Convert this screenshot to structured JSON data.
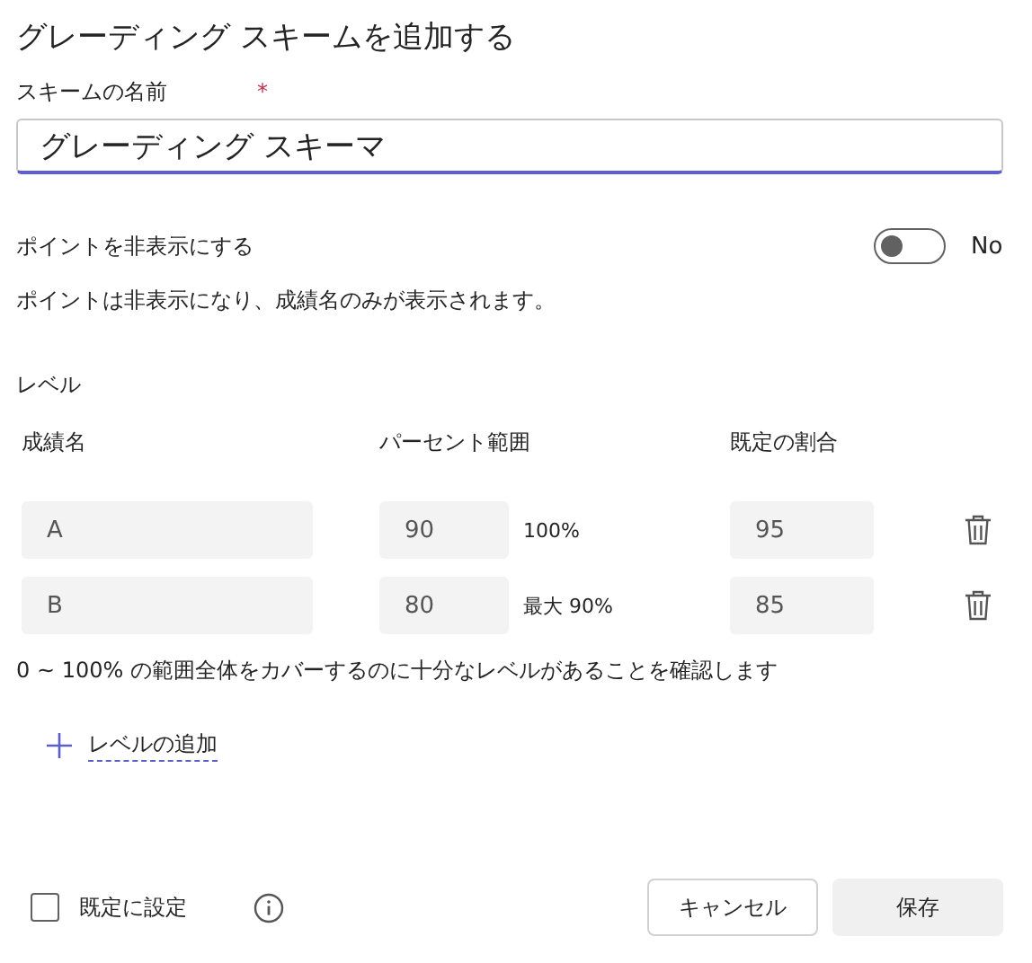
{
  "title": "グレーディング スキームを追加する",
  "scheme_name": {
    "label": "スキームの名前",
    "required_mark": "*",
    "value": "グレーディング スキーマ"
  },
  "hide_points": {
    "label": "ポイントを非表示にする",
    "on": false,
    "state_text": "No",
    "note": "ポイントは非表示になり、成績名のみが表示されます。"
  },
  "levels": {
    "title": "レベル",
    "columns": [
      "成績名",
      "パーセント範囲",
      "既定の割合"
    ],
    "rows": [
      {
        "grade": "A",
        "percent": "90",
        "range_text": "100%",
        "default": "95"
      },
      {
        "grade": "B",
        "percent": "80",
        "range_text": "最大 90%",
        "default": "85"
      }
    ],
    "note": "0 ~ 100% の範囲全体をカバーするのに十分なレベルがあることを確認します",
    "add_label": "レベルの追加"
  },
  "set_default": {
    "label": "既定に設定",
    "checked": false
  },
  "buttons": [
    "キャンセル",
    "保存"
  ]
}
